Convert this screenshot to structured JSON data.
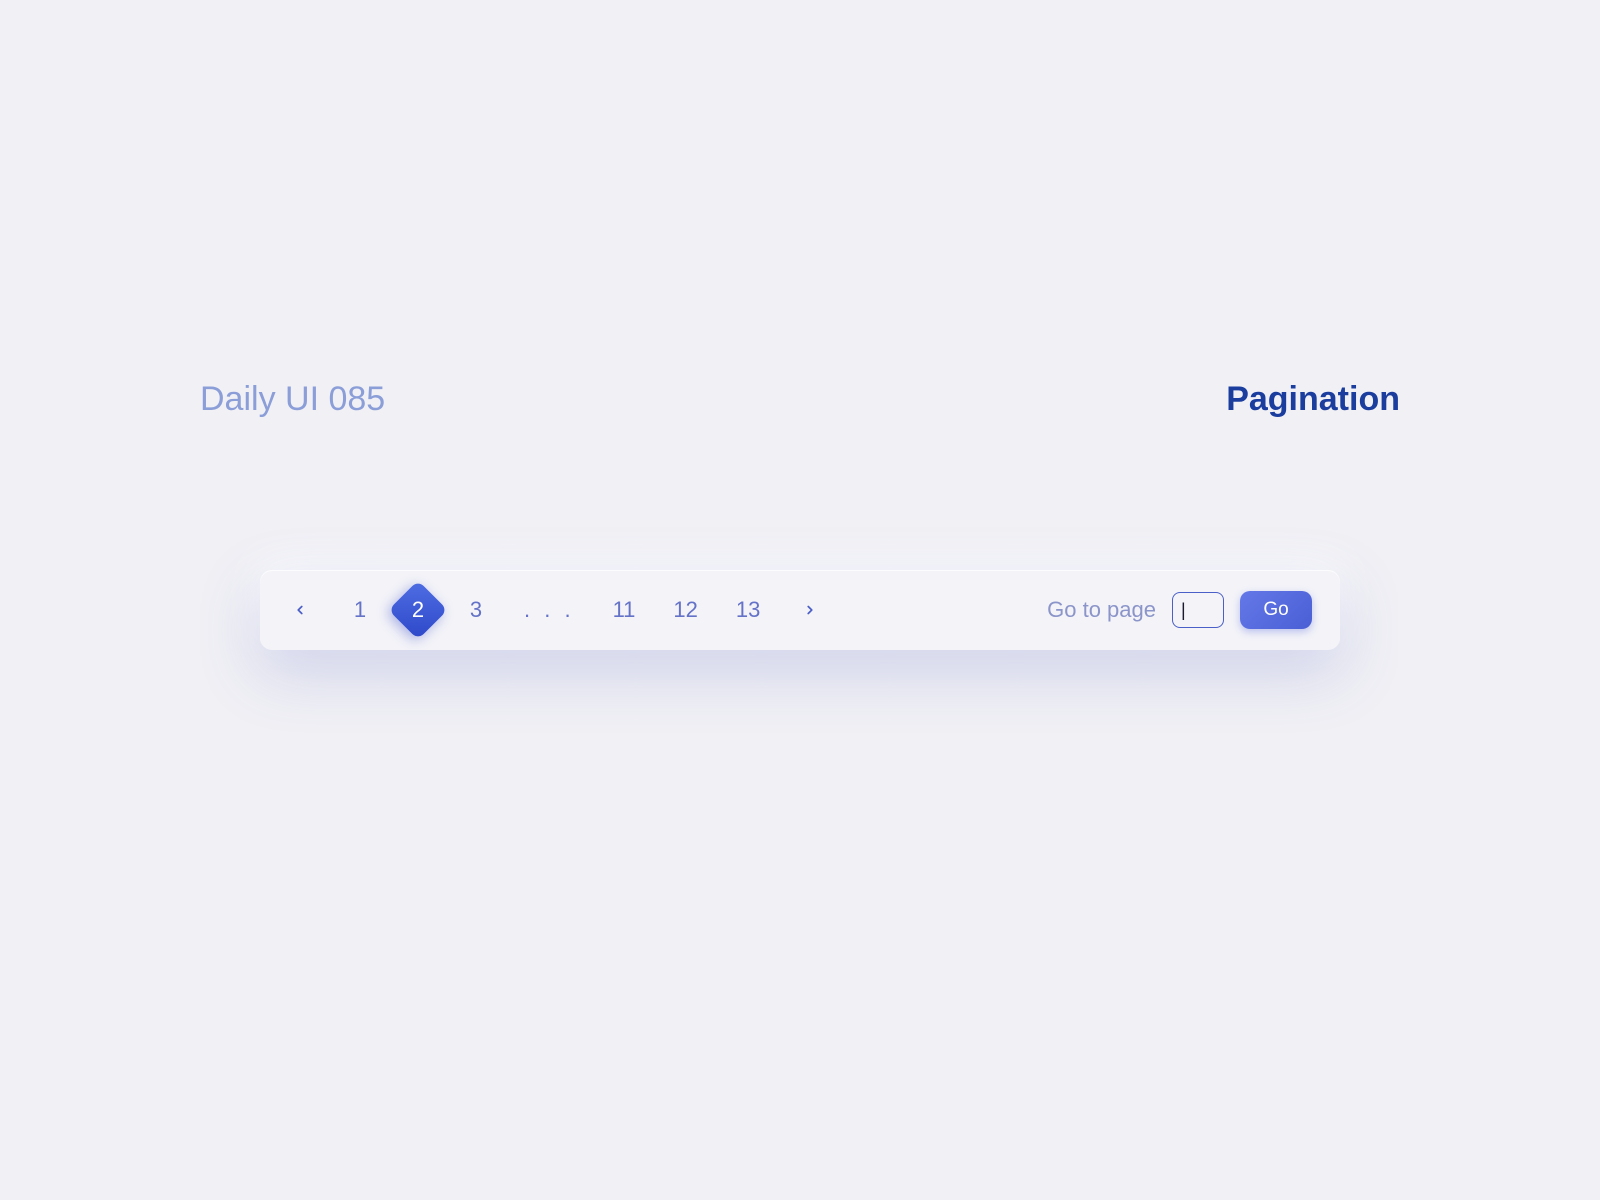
{
  "header": {
    "left": "Daily UI 085",
    "right": "Pagination"
  },
  "pagination": {
    "pages": [
      "1",
      "2",
      "3",
      ". . .",
      "11",
      "12",
      "13"
    ],
    "active_index": 1,
    "go_label": "Go to page",
    "go_input_value": "|",
    "go_button_label": "Go"
  },
  "icons": {
    "prev": "chevron-left-icon",
    "next": "chevron-right-icon"
  },
  "colors": {
    "background": "#f0f0f5",
    "muted_text": "#8b9ed8",
    "accent_dark": "#1a3d9e",
    "page_text": "#6472c7",
    "active_gradient_start": "#4f6ee3",
    "active_gradient_end": "#2e48c9"
  }
}
